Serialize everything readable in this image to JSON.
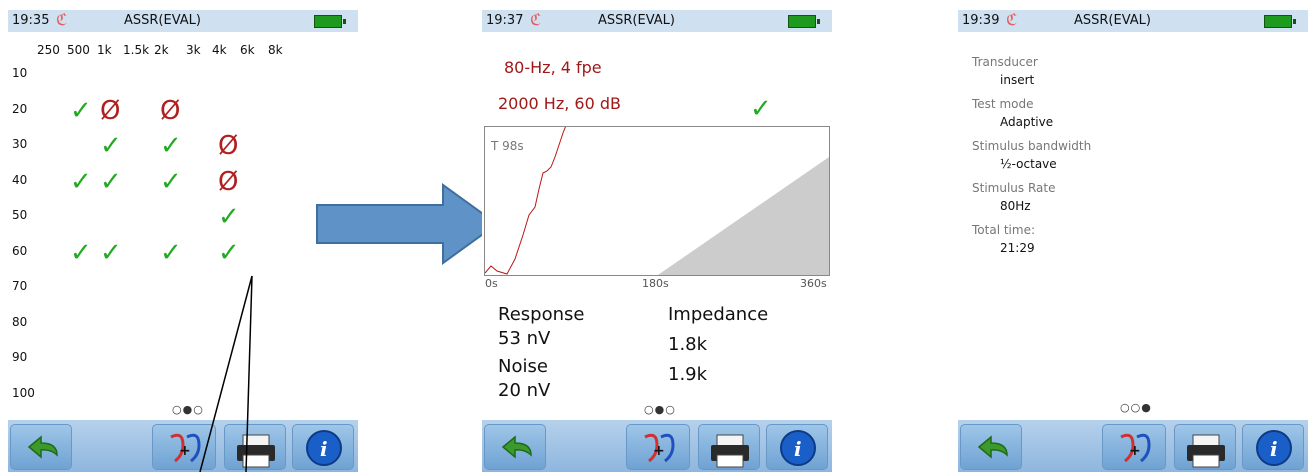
{
  "screens": [
    {
      "time": "19:35",
      "title": "ASSR(EVAL)",
      "page_dots": "○●○"
    },
    {
      "time": "19:37",
      "title": "ASSR(EVAL)",
      "page_dots": "○●○"
    },
    {
      "time": "19:39",
      "title": "ASSR(EVAL)",
      "page_dots": "○○●"
    }
  ],
  "audiogram": {
    "frequencies": [
      "250",
      "500",
      "1k",
      "1.5k",
      "2k",
      "3k",
      "4k",
      "6k",
      "8k"
    ],
    "levels": [
      "10",
      "20",
      "30",
      "40",
      "50",
      "60",
      "70",
      "80",
      "90",
      "100"
    ],
    "marks": [
      {
        "f": "500",
        "db": "20",
        "result": "pass"
      },
      {
        "f": "1k",
        "db": "20",
        "result": "fail"
      },
      {
        "f": "2k",
        "db": "20",
        "result": "fail"
      },
      {
        "f": "1k",
        "db": "30",
        "result": "pass"
      },
      {
        "f": "2k",
        "db": "30",
        "result": "pass"
      },
      {
        "f": "4k",
        "db": "30",
        "result": "fail"
      },
      {
        "f": "500",
        "db": "40",
        "result": "pass"
      },
      {
        "f": "1k",
        "db": "40",
        "result": "pass"
      },
      {
        "f": "2k",
        "db": "40",
        "result": "pass"
      },
      {
        "f": "4k",
        "db": "40",
        "result": "fail"
      },
      {
        "f": "4k",
        "db": "50",
        "result": "pass"
      },
      {
        "f": "500",
        "db": "60",
        "result": "pass"
      },
      {
        "f": "1k",
        "db": "60",
        "result": "pass"
      },
      {
        "f": "2k",
        "db": "60",
        "result": "pass"
      },
      {
        "f": "4k",
        "db": "60",
        "result": "pass"
      }
    ]
  },
  "detail": {
    "line1": "80-Hz, 4 fpe",
    "line2": "2000 Hz, 60 dB",
    "graph_label": "T 98s",
    "x_ticks": [
      "0s",
      "180s",
      "360s"
    ],
    "response_label": "Response",
    "response_value": "53 nV",
    "noise_label": "Noise",
    "noise_value": "20 nV",
    "impedance_label": "Impedance",
    "impedance_1": "1.8k",
    "impedance_2": "1.9k"
  },
  "settings": [
    {
      "key": "Transducer",
      "value": "insert"
    },
    {
      "key": "Test mode",
      "value": "Adaptive"
    },
    {
      "key": "Stimulus bandwidth",
      "value": "½-octave"
    },
    {
      "key": "Stimulus Rate",
      "value": "80Hz"
    },
    {
      "key": "Total time:",
      "value": "21:29"
    }
  ],
  "icons": {
    "back": "back-arrow-icon",
    "ear": "ear-icon",
    "print": "printer-icon",
    "info": "info-icon",
    "battery": "battery-icon"
  },
  "colors": {
    "pass": "#22aa22",
    "fail": "#b02020",
    "accent_red": "#a01818",
    "arrow": "#5f93c8"
  }
}
